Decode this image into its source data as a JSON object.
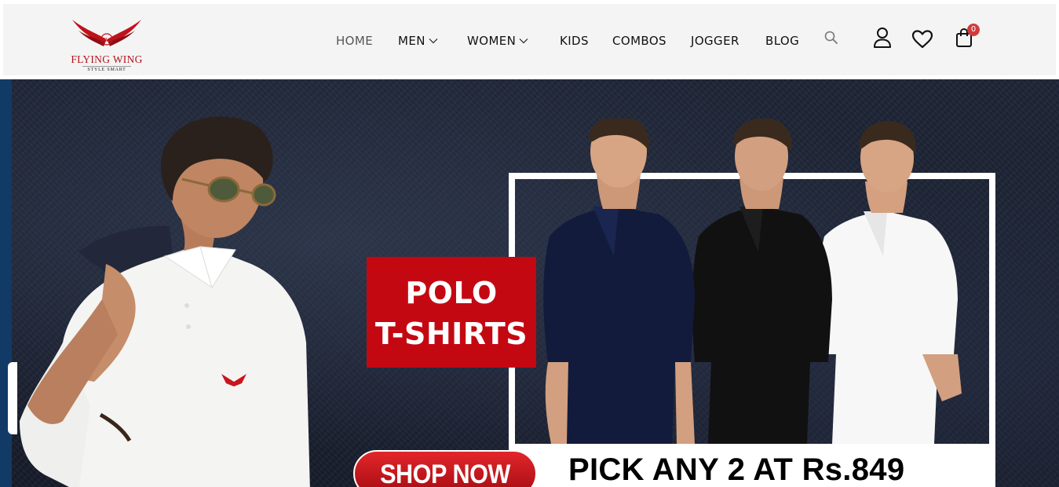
{
  "brand": {
    "name": "FLYING WING",
    "tagline": "STYLE SMART",
    "monogram": "FW",
    "color": "#b5121b"
  },
  "nav": {
    "items": [
      {
        "label": "HOME",
        "dropdown": false
      },
      {
        "label": "MEN",
        "dropdown": true
      },
      {
        "label": "WOMEN",
        "dropdown": true
      },
      {
        "label": "KIDS",
        "dropdown": false
      },
      {
        "label": "COMBOS",
        "dropdown": false
      },
      {
        "label": "JOGGER",
        "dropdown": false
      },
      {
        "label": "BLOG",
        "dropdown": false
      }
    ],
    "icons": [
      "search-icon",
      "account-icon",
      "wishlist-icon",
      "cart-icon"
    ],
    "cart_count": "0"
  },
  "hero": {
    "badge_line1": "POLO",
    "badge_line2": "T-SHIRTS",
    "cta_label": "SHOP NOW",
    "offer_text": "PICK ANY 2 AT Rs.849",
    "colors": {
      "background": "#1b2131",
      "badge": "#c40812",
      "cta": "#e2262b",
      "edge": "#123a66"
    },
    "shirt_colors": [
      "#0e1a3a",
      "#0d0d0d",
      "#ffffff"
    ]
  }
}
